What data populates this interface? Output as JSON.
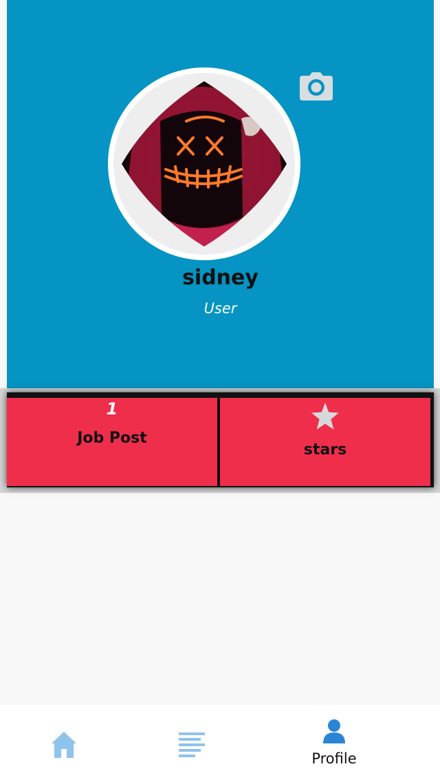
{
  "profile": {
    "name": "sidney",
    "role": "User",
    "avatar_icon": "hooded-figure-led-mask-photo",
    "camera_icon": "camera-icon"
  },
  "stats": {
    "job_post_count": "1",
    "job_post_label": "Job Post",
    "stars_icon": "star-icon",
    "stars_label": "stars"
  },
  "tabbar": {
    "items": [
      {
        "icon": "home-icon",
        "label": "",
        "active": false
      },
      {
        "icon": "list-icon",
        "label": "",
        "active": false
      },
      {
        "icon": "person-icon",
        "label": "Profile",
        "active": true
      }
    ]
  },
  "colors": {
    "header_blue": "#0594c3",
    "stat_red": "#ef2e4c",
    "tab_icon_light": "#8ec3ec",
    "tab_icon_active": "#2a86d4"
  }
}
